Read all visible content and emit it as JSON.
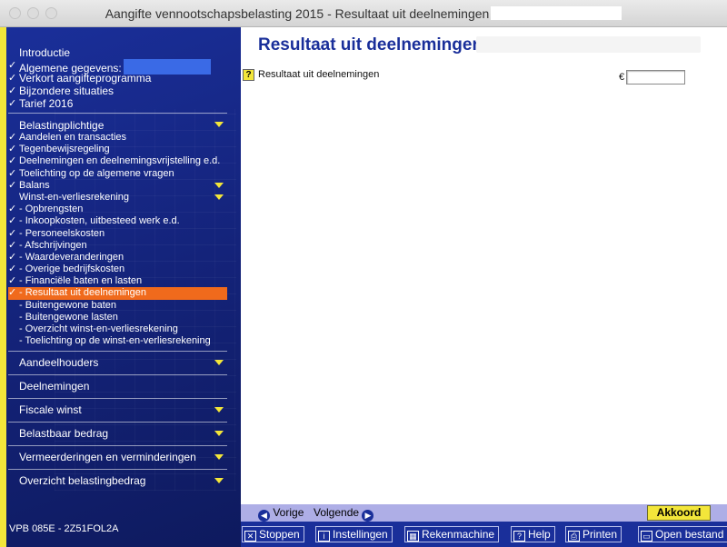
{
  "window": {
    "title": "Aangifte vennootschapsbelasting 2015 - Resultaat uit deelnemingen"
  },
  "sidebar": {
    "top_items": [
      {
        "label": "Introductie",
        "checked": false
      },
      {
        "label": "Algemene gegevens:",
        "checked": true
      },
      {
        "label": "Verkort aangifteprogramma",
        "checked": true
      },
      {
        "label": "Bijzondere situaties",
        "checked": true
      },
      {
        "label": "Tarief 2016",
        "checked": true
      }
    ],
    "group_header": {
      "label": "Belastingplichtige",
      "expandable": true
    },
    "items": [
      {
        "label": "Aandelen en transacties",
        "checked": true,
        "expandable": false
      },
      {
        "label": "Tegenbewijsregeling",
        "checked": true,
        "expandable": false
      },
      {
        "label": "Deelnemingen en deelnemingsvrijstelling e.d.",
        "checked": true,
        "expandable": false
      },
      {
        "label": "Toelichting op de algemene vragen",
        "checked": true,
        "expandable": false
      },
      {
        "label": "Balans",
        "checked": true,
        "expandable": true
      },
      {
        "label": "Winst-en-verliesrekening",
        "checked": false,
        "expandable": true
      },
      {
        "label": "- Opbrengsten",
        "checked": true,
        "expandable": false
      },
      {
        "label": "- Inkoopkosten, uitbesteed werk e.d.",
        "checked": true,
        "expandable": false
      },
      {
        "label": "- Personeelskosten",
        "checked": true,
        "expandable": false
      },
      {
        "label": "- Afschrijvingen",
        "checked": true,
        "expandable": false
      },
      {
        "label": "- Waardeveranderingen",
        "checked": true,
        "expandable": false
      },
      {
        "label": "- Overige bedrijfskosten",
        "checked": true,
        "expandable": false
      },
      {
        "label": "- Financiële baten en lasten",
        "checked": true,
        "expandable": false
      },
      {
        "label": "- Resultaat uit deelnemingen",
        "checked": true,
        "expandable": false,
        "active": true
      },
      {
        "label": "- Buitengewone baten",
        "checked": false,
        "expandable": false
      },
      {
        "label": "- Buitengewone lasten",
        "checked": false,
        "expandable": false
      },
      {
        "label": "- Overzicht winst-en-verliesrekening",
        "checked": false,
        "expandable": false
      },
      {
        "label": "- Toelichting op de winst-en-verliesrekening",
        "checked": false,
        "expandable": false
      }
    ],
    "sections": [
      {
        "label": "Aandeelhouders",
        "expandable": true
      },
      {
        "label": "Deelnemingen",
        "expandable": false
      },
      {
        "label": "Fiscale winst",
        "expandable": true
      },
      {
        "label": "Belastbaar bedrag",
        "expandable": true
      },
      {
        "label": "Vermeerderingen en verminderingen",
        "expandable": true
      },
      {
        "label": "Overzicht belastingbedrag",
        "expandable": true
      }
    ],
    "footer": "VPB 085E - 2Z51FOL2A"
  },
  "main": {
    "title": "Resultaat uit deelnemingen",
    "field_label": "Resultaat uit deelnemingen",
    "currency": "€",
    "field_value": ""
  },
  "navbar": {
    "prev_label": "Vorige",
    "next_label": "Volgende",
    "ok_label": "Akkoord"
  },
  "toolbar": {
    "buttons": [
      {
        "label": "Stoppen",
        "icon": "close-icon",
        "glyph": "✕"
      },
      {
        "label": "Instellingen",
        "icon": "info-icon",
        "glyph": "i"
      },
      {
        "label": "Rekenmachine",
        "icon": "calculator-icon",
        "glyph": "▦"
      },
      {
        "label": "Help",
        "icon": "help-icon",
        "glyph": "?"
      },
      {
        "label": "Printen",
        "icon": "printer-icon",
        "glyph": "⎙"
      },
      {
        "label": "Open bestand",
        "icon": "folder-icon",
        "glyph": "▭"
      }
    ]
  },
  "colors": {
    "sidebar_bg": "#1a2f9a",
    "accent_yellow": "#f3e63a",
    "active_orange": "#f06a1c",
    "title_blue": "#1a2f9a"
  }
}
